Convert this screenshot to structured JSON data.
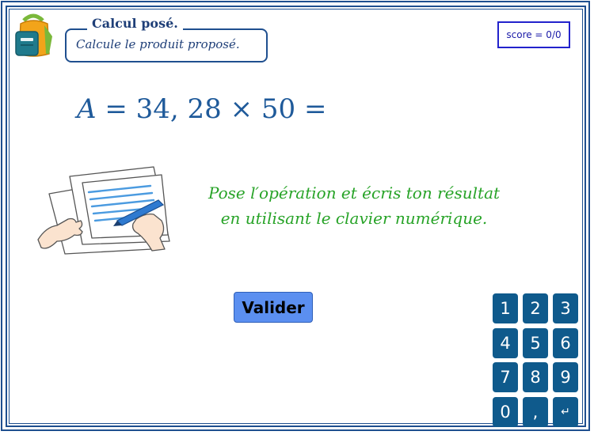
{
  "header": {
    "title": "Calcul posé.",
    "subtitle": "Calcule le produit proposé."
  },
  "score": {
    "label": "score = 0/0"
  },
  "exercise": {
    "variable": "A",
    "expression": " = 34, 28 × 50 ="
  },
  "instruction": {
    "line1": "Pose l′opération et écris ton résultat",
    "line2": "en utilisant le clavier numérique."
  },
  "actions": {
    "validate_label": "Valider"
  },
  "keypad": {
    "keys": [
      "1",
      "2",
      "3",
      "4",
      "5",
      "6",
      "7",
      "8",
      "9",
      "0",
      ",",
      "↵"
    ]
  },
  "colors": {
    "frame": "#1f4f8f",
    "equation": "#1f5a9a",
    "instruction": "#27a327",
    "validate_button": "#5b8ff0",
    "keypad": "#0f5a8c"
  },
  "icons": {
    "logo": "school-backpack-icon",
    "illustration": "writing-hands-icon",
    "enter_key": "enter-return-icon"
  }
}
